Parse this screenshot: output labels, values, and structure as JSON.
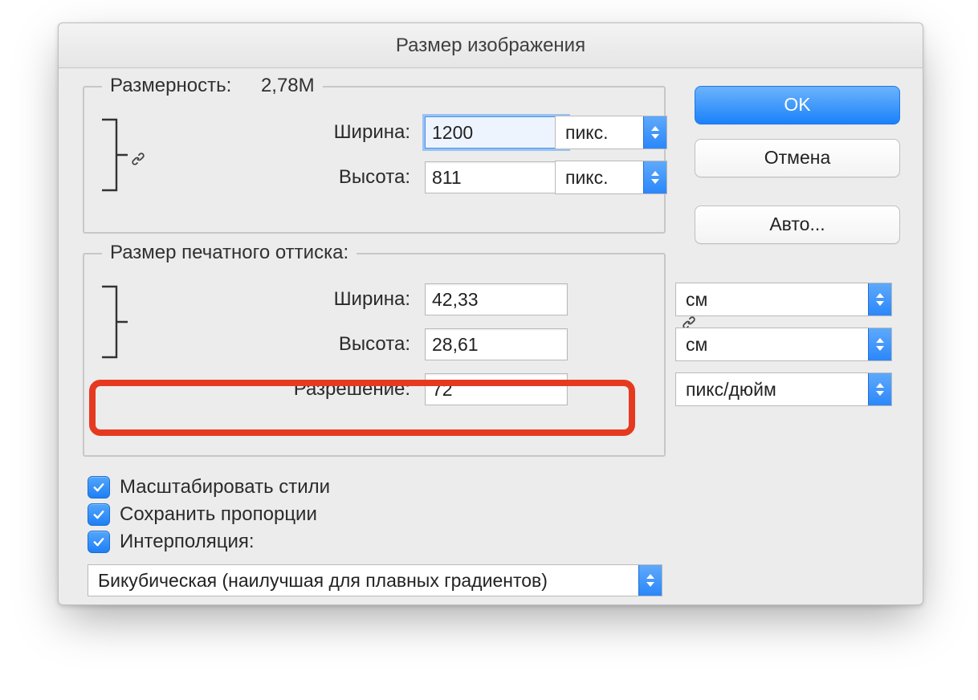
{
  "dialog": {
    "title": "Размер изображения",
    "buttons": {
      "ok": "OK",
      "cancel": "Отмена",
      "auto": "Авто..."
    },
    "pixel_dimensions": {
      "legend_label": "Размерность:",
      "legend_value": "2,78M",
      "width_label": "Ширина:",
      "width_value": "1200",
      "width_unit": "пикс.",
      "height_label": "Высота:",
      "height_value": "811",
      "height_unit": "пикс."
    },
    "print_size": {
      "legend_label": "Размер печатного оттиска:",
      "width_label": "Ширина:",
      "width_value": "42,33",
      "width_unit": "см",
      "height_label": "Высота:",
      "height_value": "28,61",
      "height_unit": "см",
      "resolution_label": "Разрешение:",
      "resolution_value": "72",
      "resolution_unit": "пикс/дюйм"
    },
    "options": {
      "scale_styles": "Масштабировать стили",
      "constrain_proportions": "Сохранить пропорции",
      "resample": "Интерполяция:",
      "resample_method": "Бикубическая (наилучшая для плавных градиентов)"
    }
  }
}
